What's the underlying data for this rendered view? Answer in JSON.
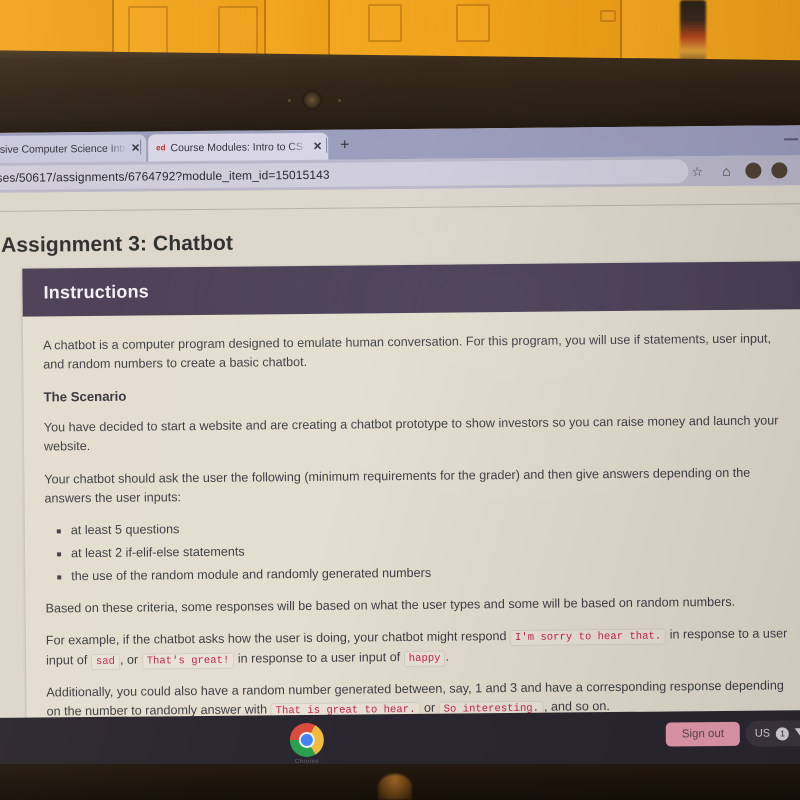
{
  "browser": {
    "tabs": [
      {
        "title": "hesive Computer Science Intr",
        "favicon": "",
        "close_label": "✕",
        "active": false
      },
      {
        "title": "Course Modules: Intro to CS - Te",
        "favicon": "ed",
        "close_label": "✕",
        "active": true
      }
    ],
    "new_tab_label": "+",
    "minimize_label": "",
    "url": "ses/50617/assignments/6764792?module_item_id=15015143",
    "star_icon": "☆",
    "extensions_icon": "⌂",
    "profile_icon_1": "●",
    "profile_icon_2": "●"
  },
  "page": {
    "assignment_title": "Assignment 3: Chatbot",
    "card": {
      "header": "Instructions",
      "intro": "A chatbot is a computer program designed to emulate human conversation. For this program, you will use if statements, user input, and random numbers to create a basic chatbot.",
      "scenario_heading": "The Scenario",
      "scenario_text": "You have decided to start a website and are creating a chatbot prototype to show investors so you can raise money and launch your website.",
      "requirements_intro": "Your chatbot should ask the user the following (minimum requirements for the grader) and then give answers depending on the answers the user inputs:",
      "requirements": [
        "at least 5 questions",
        "at least 2 if-elif-else statements",
        "the use of the random module and randomly generated numbers"
      ],
      "criteria_text": "Based on these criteria, some responses will be based on what the user types and some will be based on random numbers.",
      "example_part_1": "For example, if the chatbot asks how the user is doing, your chatbot might respond",
      "example_code_1": "I'm sorry to hear that.",
      "example_part_2": "in response to a user input of",
      "example_code_2": "sad",
      "example_part_3": ", or",
      "example_code_3": "That's great!",
      "example_part_4": "in response to a user input of",
      "example_code_4": "happy",
      "example_part_5": ".",
      "additional_part_1": "Additionally, you could also have a random number generated between, say, 1 and 3 and have a corresponding response depending on the number to randomly answer with",
      "additional_code_1": "That is great to hear.",
      "additional_part_2": "or",
      "additional_code_2": "So interesting.",
      "additional_part_3": ", and so on."
    }
  },
  "shelf": {
    "launcher_label": "Chrome",
    "sign_out_label": "Sign out",
    "tray_locale": "US",
    "tray_count": "1"
  },
  "colors": {
    "card_header": "#4a3d55",
    "code_text": "#c7254e",
    "sign_out": "#e79cb1",
    "shelf": "#2b2730",
    "page_bg": "#dcd7cb"
  }
}
